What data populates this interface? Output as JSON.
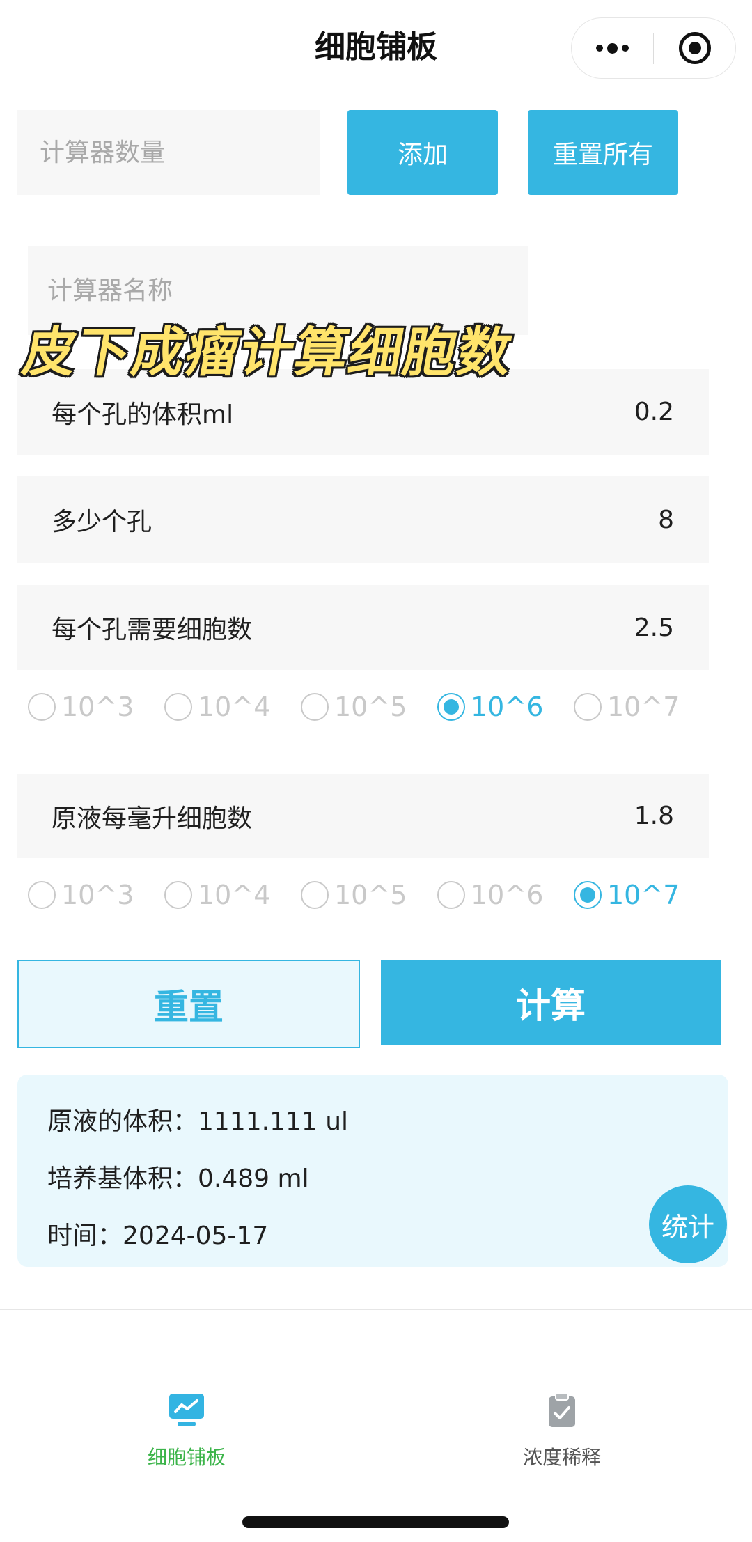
{
  "nav": {
    "title": "细胞铺板",
    "more_icon": "more-dots-icon",
    "close_icon": "target-circle-icon"
  },
  "calculator_count": {
    "placeholder": "计算器数量"
  },
  "actions": {
    "add_label": "添加",
    "reset_all_label": "重置所有"
  },
  "calculator_name": {
    "placeholder": "计算器名称"
  },
  "overlay_caption": "皮下成瘤计算细胞数",
  "fields": [
    {
      "label": "每个孔的体积ml",
      "value": "0.2"
    },
    {
      "label": "多少个孔",
      "value": "8"
    },
    {
      "label": "每个孔需要细胞数",
      "value": "2.5"
    },
    {
      "label": "原液每毫升细胞数",
      "value": "1.8"
    }
  ],
  "exponent_groups": [
    {
      "options": [
        "10^3",
        "10^4",
        "10^5",
        "10^6",
        "10^7"
      ],
      "selected": "10^6"
    },
    {
      "options": [
        "10^3",
        "10^4",
        "10^5",
        "10^6",
        "10^7"
      ],
      "selected": "10^7"
    }
  ],
  "buttons": {
    "reset_label": "重置",
    "calculate_label": "计算"
  },
  "result": {
    "lines": [
      {
        "label": "原液的体积：",
        "value": "1111.111 ul"
      },
      {
        "label": "培养基体积：",
        "value": "0.489 ml"
      },
      {
        "label": "时间：",
        "value": "2024-05-17"
      }
    ]
  },
  "stats_button": {
    "label": "统计"
  },
  "tabbar": {
    "items": [
      {
        "label": "细胞铺板",
        "icon": "monitor-chart-icon",
        "active": true
      },
      {
        "label": "浓度稀释",
        "icon": "clipboard-check-icon",
        "active": false
      }
    ]
  },
  "colors": {
    "accent": "#35b6e1",
    "accent_soft": "#e9f8fd",
    "field_background": "#f7f7f7",
    "tab_active": "#3cb44a",
    "tab_inactive": "#555555",
    "caption_fill": "#ffe46b",
    "caption_outline": "#1c1c1c"
  }
}
